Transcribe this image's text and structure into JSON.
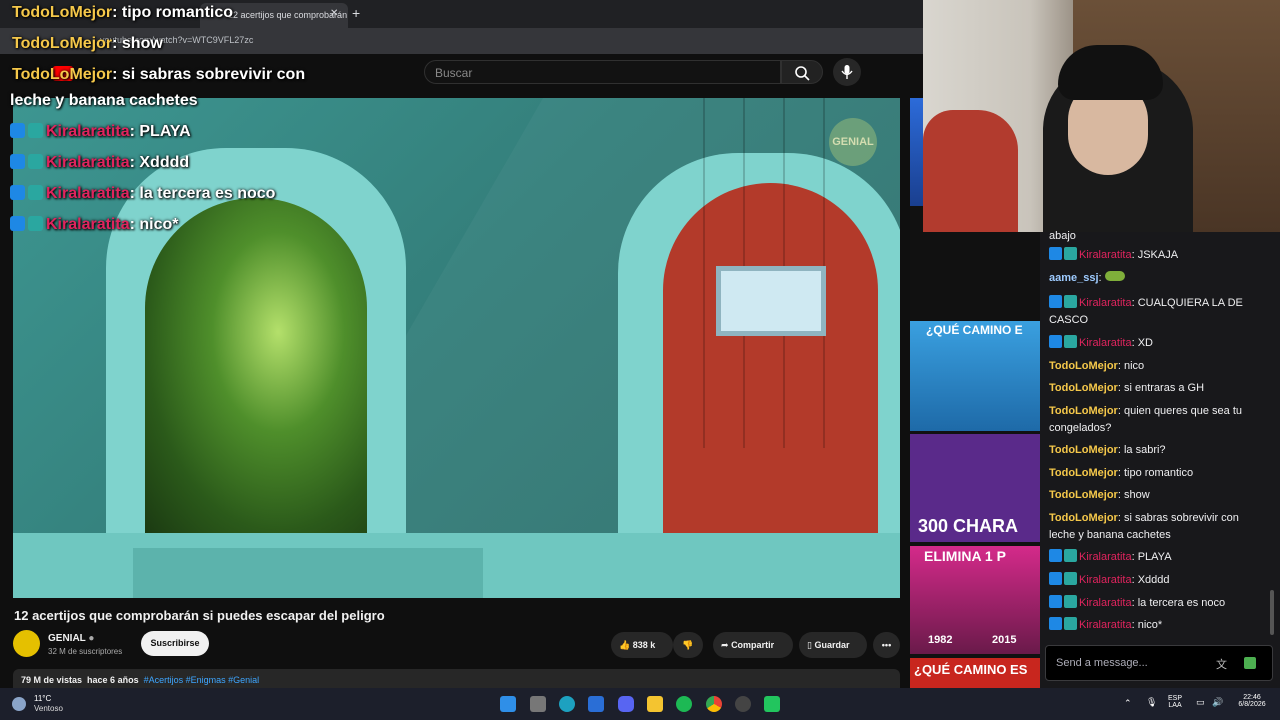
{
  "browser": {
    "tab_title": "12 acertijos que comprobarán",
    "url": "youtube.com/watch?v=WTC9VFL27zc"
  },
  "youtube": {
    "search_placeholder": "Buscar",
    "video_badge": "GENIAL",
    "video_title": "12 acertijos que comprobarán si puedes escapar del peligro",
    "channel_name": "GENIAL",
    "channel_subs": "32 M de suscriptores",
    "subscribe_label": "Suscribirse",
    "likes": "838 k",
    "share_label": "Compartir",
    "save_label": "Guardar",
    "views": "79 M de vistas",
    "age": "hace 6 años",
    "tags": "#Acertijos #Enigmas #Genial"
  },
  "overlay": [
    {
      "user": "TodoLoMejor",
      "text": ": tipo romantico"
    },
    {
      "user": "TodoLoMejor",
      "text": ": show"
    },
    {
      "user": "TodoLoMejor",
      "text": ": si sabras sobrevivir con"
    },
    {
      "text": "leche y banana cachetes"
    },
    {
      "user": "Kiralaratita",
      "text": ": PLAYA"
    },
    {
      "user": "Kiralaratita",
      "text": ": Xdddd"
    },
    {
      "user": "Kiralaratita",
      "text": ": la tercera es noco"
    },
    {
      "user": "Kiralaratita",
      "text": ": nico*"
    }
  ],
  "thumbnails": [
    "¿QUÉ CAMINO E",
    "300 CHARA",
    "ELIMINA 1 P",
    "¿QUÉ CAMINO ES"
  ],
  "thumb_years": [
    "1982",
    "2015"
  ],
  "chat": {
    "top": "abajo",
    "messages": [
      {
        "user": "Kiralaratita",
        "text": "JSKAJA"
      },
      {
        "user": "aame_ssj",
        "text": ""
      },
      {
        "user": "Kiralaratita",
        "text": "CUALQUIERA LA DE"
      },
      {
        "text": "CASCO"
      },
      {
        "user": "Kiralaratita",
        "text": "XD"
      },
      {
        "user": "TodoLoMejor",
        "text": "nico"
      },
      {
        "user": "TodoLoMejor",
        "text": "si entraras a GH"
      },
      {
        "user": "TodoLoMejor",
        "text": "quien queres que sea tu"
      },
      {
        "text": "congelados?"
      },
      {
        "user": "TodoLoMejor",
        "text": "la sabri?"
      },
      {
        "user": "TodoLoMejor",
        "text": "tipo romantico"
      },
      {
        "user": "TodoLoMejor",
        "text": "show"
      },
      {
        "user": "TodoLoMejor",
        "text": "si sabras sobrevivir con"
      },
      {
        "text": "leche y banana cachetes"
      },
      {
        "user": "Kiralaratita",
        "text": "PLAYA"
      },
      {
        "user": "Kiralaratita",
        "text": "Xdddd"
      },
      {
        "user": "Kiralaratita",
        "text": "la tercera es noco"
      },
      {
        "user": "Kiralaratita",
        "text": "nico*"
      }
    ],
    "input_placeholder": "Send a message..."
  },
  "taskbar": {
    "temp": "11°C",
    "weather": "Ventoso",
    "lang1": "ESP",
    "lang2": "LAA",
    "time": "22:46",
    "date": "6/8/2026"
  },
  "colors": {
    "todolomejor": "#f5c84a",
    "kiralaratita": "#e0245e",
    "aame": "#9ecbff"
  }
}
